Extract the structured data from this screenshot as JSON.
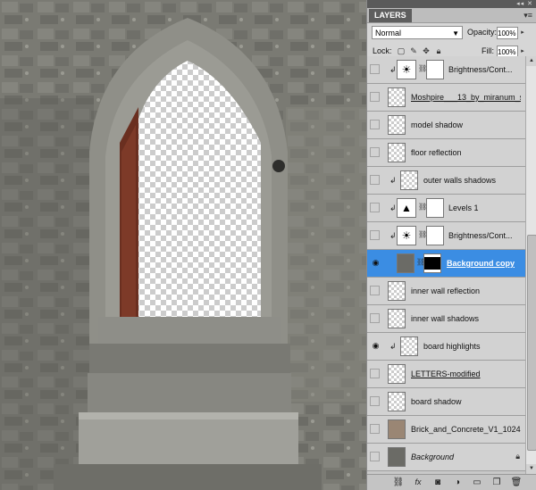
{
  "panel": {
    "tab_label": "LAYERS",
    "blend_mode": "Normal",
    "opacity_label": "Opacity:",
    "opacity_value": "100%",
    "lock_label": "Lock:",
    "fill_label": "Fill:",
    "fill_value": "100%"
  },
  "layers": [
    {
      "name": "Brightness/Cont...",
      "type": "adjustment",
      "icon": "brightness-icon",
      "clipped": true,
      "visible": false
    },
    {
      "name": "Moshpire___13_by_miranum_s...",
      "type": "pixel",
      "clipped": false,
      "visible": false,
      "underline": true
    },
    {
      "name": "model shadow",
      "type": "pixel",
      "clipped": false,
      "visible": false
    },
    {
      "name": "floor reflection",
      "type": "pixel",
      "clipped": false,
      "visible": false
    },
    {
      "name": "outer walls shadows",
      "type": "pixel",
      "clipped": true,
      "visible": false
    },
    {
      "name": "Levels 1",
      "type": "adjustment",
      "icon": "levels-icon",
      "clipped": true,
      "visible": false
    },
    {
      "name": "Brightness/Cont...",
      "type": "adjustment",
      "icon": "brightness-icon",
      "clipped": true,
      "visible": false
    },
    {
      "name": "Background copy",
      "type": "pixel-mask",
      "clipped": false,
      "visible": true,
      "selected": true
    },
    {
      "name": "inner wall reflection",
      "type": "pixel",
      "clipped": false,
      "visible": false
    },
    {
      "name": "inner wall shadows",
      "type": "pixel",
      "clipped": false,
      "visible": false
    },
    {
      "name": "board highlights",
      "type": "pixel",
      "clipped": true,
      "visible": true
    },
    {
      "name": "LETTERS-modified",
      "type": "pixel",
      "clipped": false,
      "visible": false,
      "underline": true
    },
    {
      "name": "board shadow",
      "type": "pixel",
      "clipped": false,
      "visible": false
    },
    {
      "name": "Brick_and_Concrete_V1_1024",
      "type": "pixel",
      "clipped": false,
      "visible": false
    },
    {
      "name": "Background",
      "type": "background",
      "clipped": false,
      "visible": false,
      "italic": true,
      "locked": true
    }
  ],
  "bottom_icons": [
    "link-icon",
    "fx-icon",
    "add-mask-icon",
    "adjustment-icon",
    "group-icon",
    "new-layer-icon",
    "trash-icon"
  ],
  "colors": {
    "selection": "#3b8de3",
    "panel_bg": "#d6d6d6"
  }
}
